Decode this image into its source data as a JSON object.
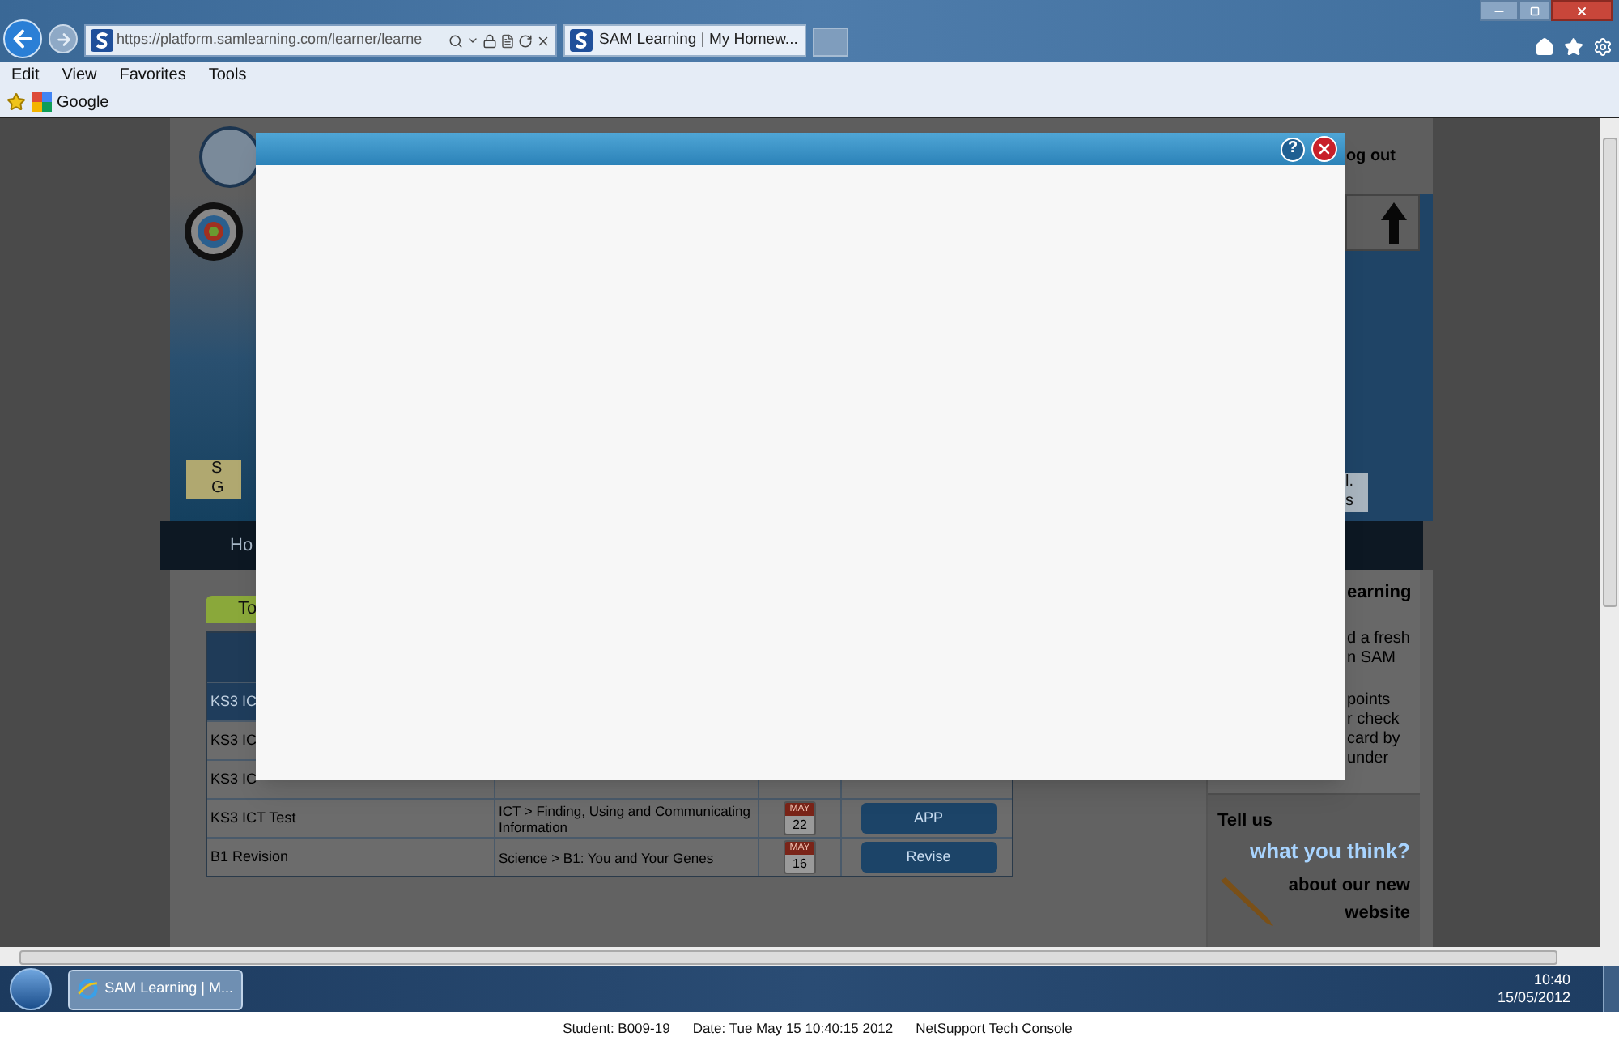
{
  "browser": {
    "address": "https://platform.samlearning.com/learner/learne",
    "tab_title": "SAM Learning | My Homew...",
    "menu": [
      "Edit",
      "View",
      "Favorites",
      "Tools"
    ],
    "favorites": [
      "Google"
    ]
  },
  "page": {
    "header_link": "og out",
    "banner_left": [
      "S",
      "G"
    ],
    "banner_right": [
      "l.",
      "s"
    ],
    "nav_item": "Ho",
    "tab": "To",
    "table_rows": [
      {
        "name": "KS3 IC",
        "selected": true
      },
      {
        "name": "KS3 IC",
        "selected": false
      },
      {
        "name": "KS3 IC",
        "selected": false
      },
      {
        "name": "KS3 ICT Test",
        "topic": "ICT > Finding, Using and Communicating Information",
        "month": "MAY",
        "day": "22",
        "action": "APP",
        "selected": false
      },
      {
        "name": "B1 Revision",
        "topic": "Science > B1: You and Your Genes",
        "month": "MAY",
        "day": "16",
        "action": "Revise",
        "selected": false
      }
    ],
    "sidebar_heading": "earning",
    "sidebar_paragraphs": [
      [
        "d a fresh",
        "n SAM"
      ],
      [
        "points",
        "r check",
        "card by",
        "under"
      ]
    ],
    "promo": {
      "line_1": "Tell us",
      "line_2": "what you think?",
      "line_3": "about our new",
      "line_4": "website"
    }
  },
  "dialog": {
    "help": "?"
  },
  "taskbar": {
    "items": [
      {
        "label": "SAM Learning | M...",
        "selected": true
      }
    ],
    "time": "10:40",
    "date": "15/05/2012"
  },
  "status_line": [
    "Student: B009-19",
    "Date: Tue May 15 10:40:15 2012",
    "NetSupport Tech Console"
  ]
}
